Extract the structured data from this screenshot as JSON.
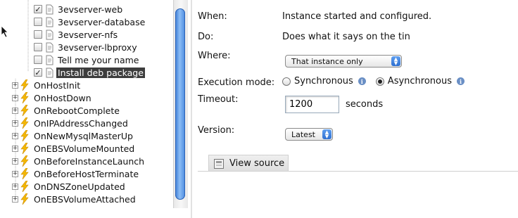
{
  "tree": {
    "scripts": [
      {
        "label": "3evserver-web",
        "checked": true
      },
      {
        "label": "3evserver-database",
        "checked": false
      },
      {
        "label": "3evserver-nfs",
        "checked": false
      },
      {
        "label": "3evserver-lbproxy",
        "checked": false
      },
      {
        "label": "Tell me your name",
        "checked": false
      },
      {
        "label": "Install deb package",
        "checked": true,
        "selected": true
      }
    ],
    "events": [
      "OnHostInit",
      "OnHostDown",
      "OnRebootComplete",
      "OnIPAddressChanged",
      "OnNewMysqlMasterUp",
      "OnEBSVolumeMounted",
      "OnBeforeInstanceLaunch",
      "OnBeforeHostTerminate",
      "OnDNSZoneUpdated",
      "OnEBSVolumeAttached"
    ]
  },
  "details": {
    "when_label": "When:",
    "when_value": "Instance started and configured.",
    "do_label": "Do:",
    "do_value": "Does what it says on the tin",
    "where_label": "Where:",
    "where_value": "That instance only",
    "exec_label": "Execution mode:",
    "exec_options": [
      "Synchronous",
      "Asynchronous"
    ],
    "exec_selected": "Asynchronous",
    "timeout_label": "Timeout:",
    "timeout_value": "1200",
    "timeout_unit": "seconds",
    "version_label": "Version:",
    "version_value": "Latest",
    "view_source": "View source"
  },
  "colors": {
    "selection": "#3d3d3d",
    "scroll_thumb": "#3a7bd5",
    "bolt": "#f5b800",
    "info": "#6a8fc5"
  }
}
